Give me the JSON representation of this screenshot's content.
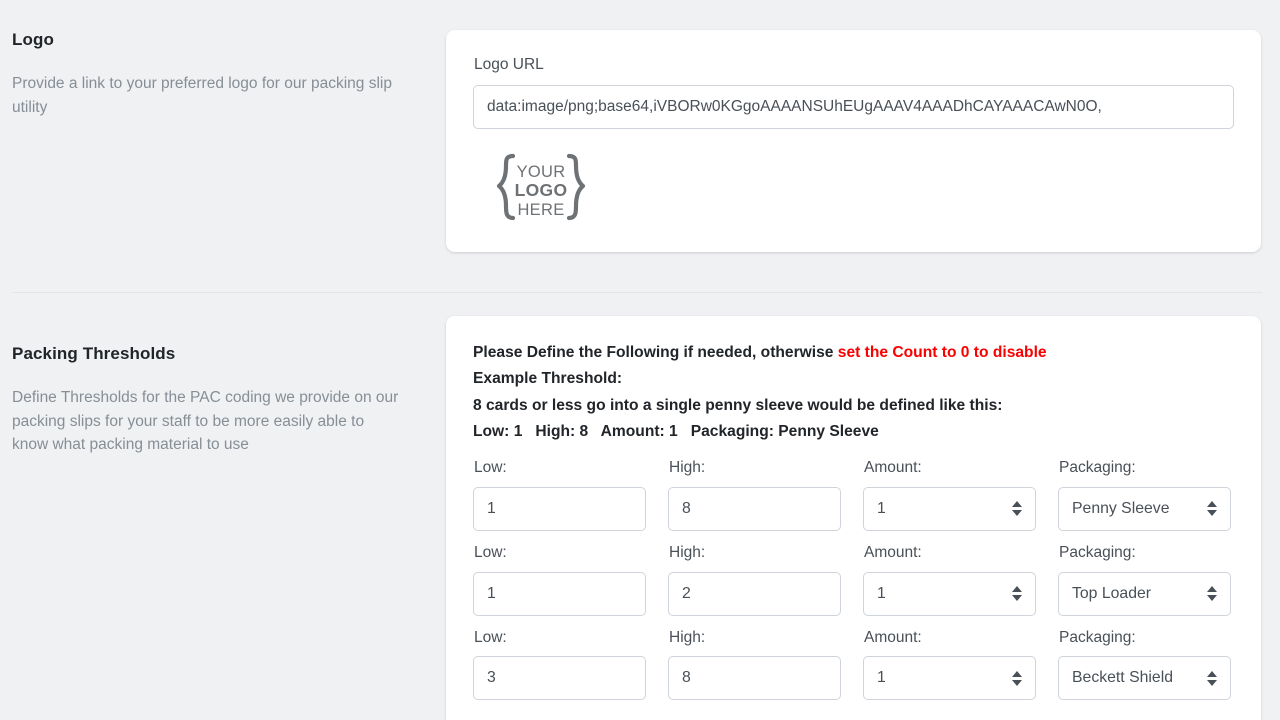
{
  "sections": {
    "logo": {
      "title": "Logo",
      "description": "Provide a link to your preferred logo for our packing slip utility",
      "url_label": "Logo URL",
      "url_value": "data:image/png;base64,iVBORw0KGgoAAAANSUhEUgAAAV4AAADhCAYAAACAwN0O,",
      "url_placeholder": "Logo URL",
      "preview_alt": "YOUR LOGO HERE placeholder logo",
      "preview_text_top": "YOUR",
      "preview_text_mid": "LOGO",
      "preview_text_bottom": "HERE"
    },
    "thresholds": {
      "title": "Packing Thresholds",
      "description": "Define Thresholds for the PAC coding we provide on our packing slips for your staff to be more easily able to know what packing material to use",
      "instructions": {
        "line1_a": "Please Define the Following if needed, otherwise ",
        "line1_b": "set the Count to 0 to disable",
        "line2": "Example Threshold:",
        "line3": "8 cards or less go into a single penny sleeve would be defined like this:",
        "line4": "Low: 1   High: 8   Amount: 1   Packaging: Penny Sleeve"
      },
      "labels": {
        "low": "Low:",
        "high": "High:",
        "amount": "Amount:",
        "packaging": "Packaging:"
      },
      "rows": [
        {
          "low": "1",
          "high": "8",
          "amount": "1",
          "packaging": "Penny Sleeve"
        },
        {
          "low": "1",
          "high": "2",
          "amount": "1",
          "packaging": "Top Loader"
        },
        {
          "low": "3",
          "high": "8",
          "amount": "1",
          "packaging": "Beckett Shield"
        }
      ]
    }
  },
  "colors": {
    "page_background": "#f0f1f3",
    "card_background": "#ffffff",
    "title_text": "#212529",
    "muted_text": "#868e96",
    "label_text": "#495057",
    "input_border": "#ced4da",
    "alert_red": "#fa0000",
    "divider": "#e3e5e8"
  }
}
